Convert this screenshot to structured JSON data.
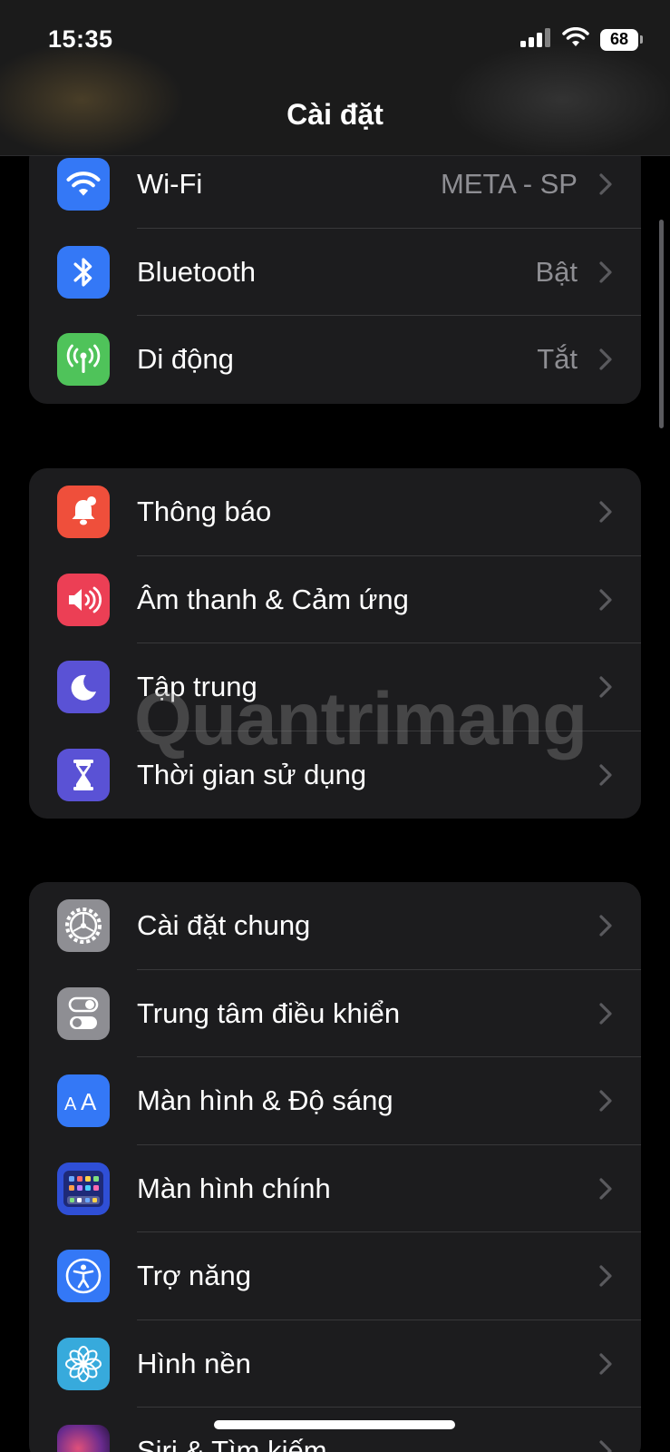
{
  "status": {
    "time": "15:35",
    "battery": "68"
  },
  "nav": {
    "title": "Cài đặt"
  },
  "groups": [
    {
      "items": [
        {
          "label": "Wi-Fi",
          "value": "META - SP",
          "icon": "wifi-icon",
          "color": "#3478f6"
        },
        {
          "label": "Bluetooth",
          "value": "Bật",
          "icon": "bluetooth-icon",
          "color": "#3478f6"
        },
        {
          "label": "Di động",
          "value": "Tắt",
          "icon": "cellular-icon",
          "color": "#4fc35a"
        }
      ]
    },
    {
      "items": [
        {
          "label": "Thông báo",
          "icon": "bell-icon",
          "color": "#ef4f3b"
        },
        {
          "label": "Âm thanh & Cảm ứng",
          "icon": "speaker-icon",
          "color": "#ec3f55"
        },
        {
          "label": "Tập trung",
          "icon": "moon-icon",
          "color": "#5a52d5"
        },
        {
          "label": "Thời gian sử dụng",
          "icon": "hourglass-icon",
          "color": "#5a52d5"
        }
      ]
    },
    {
      "items": [
        {
          "label": "Cài đặt chung",
          "icon": "gear-icon",
          "color": "#8e8e93"
        },
        {
          "label": "Trung tâm điều khiển",
          "icon": "toggles-icon",
          "color": "#8e8e93"
        },
        {
          "label": "Màn hình & Độ sáng",
          "icon": "text-size-icon",
          "color": "#3478f6"
        },
        {
          "label": "Màn hình chính",
          "icon": "home-grid-icon",
          "color": "#2f4fd6"
        },
        {
          "label": "Trợ năng",
          "icon": "accessibility-icon",
          "color": "#3478f6"
        },
        {
          "label": "Hình nền",
          "icon": "flower-icon",
          "color": "#37aadc"
        },
        {
          "label": "Siri & Tìm kiếm",
          "icon": "siri-icon",
          "color": "#3a1c4a"
        }
      ]
    }
  ],
  "watermark": "Quantrimang"
}
